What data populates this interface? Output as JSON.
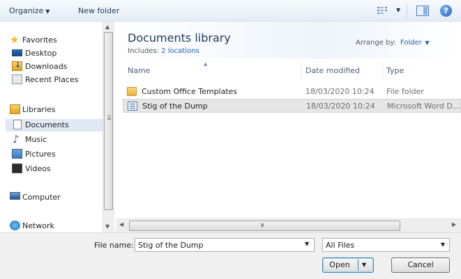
{
  "toolbar": {
    "organize_label": "Organize",
    "new_folder_label": "New folder"
  },
  "nav": {
    "items": [
      {
        "label": "Favorites",
        "icon": "star-icon"
      },
      {
        "label": "Desktop",
        "icon": "desktop-icon"
      },
      {
        "label": "Downloads",
        "icon": "downloads-folder-icon"
      },
      {
        "label": "Recent Places",
        "icon": "recent-places-icon"
      },
      {
        "label": "Libraries",
        "icon": "libraries-icon"
      },
      {
        "label": "Documents",
        "icon": "documents-icon",
        "selected": true
      },
      {
        "label": "Music",
        "icon": "music-icon"
      },
      {
        "label": "Pictures",
        "icon": "pictures-icon"
      },
      {
        "label": "Videos",
        "icon": "videos-icon"
      },
      {
        "label": "Computer",
        "icon": "computer-icon"
      },
      {
        "label": "Network",
        "icon": "network-icon"
      }
    ]
  },
  "library": {
    "title": "Documents library",
    "includes_prefix": "Includes:",
    "includes_link": "2 locations",
    "arrange_label": "Arrange by:",
    "arrange_value": "Folder"
  },
  "columns": {
    "name": "Name",
    "date_modified": "Date modified",
    "type": "Type"
  },
  "files": [
    {
      "name": "Custom Office Templates",
      "date": "18/03/2020 10:24",
      "type": "File folder",
      "icon": "folder-icon"
    },
    {
      "name": "Stig of the Dump",
      "date": "18/03/2020 10:24",
      "type": "Microsoft Word D...",
      "icon": "word-document-icon",
      "selected": true
    }
  ],
  "hscroll": {
    "grip": "III"
  },
  "bottom": {
    "file_name_label": "File name:",
    "file_name_value": "Stig of the Dump",
    "file_type_value": "All Files",
    "open_label": "Open",
    "cancel_label": "Cancel"
  },
  "colors": {
    "accent": "#1f5fb7",
    "title": "#1e395b",
    "selection": "#dfe8f3"
  }
}
